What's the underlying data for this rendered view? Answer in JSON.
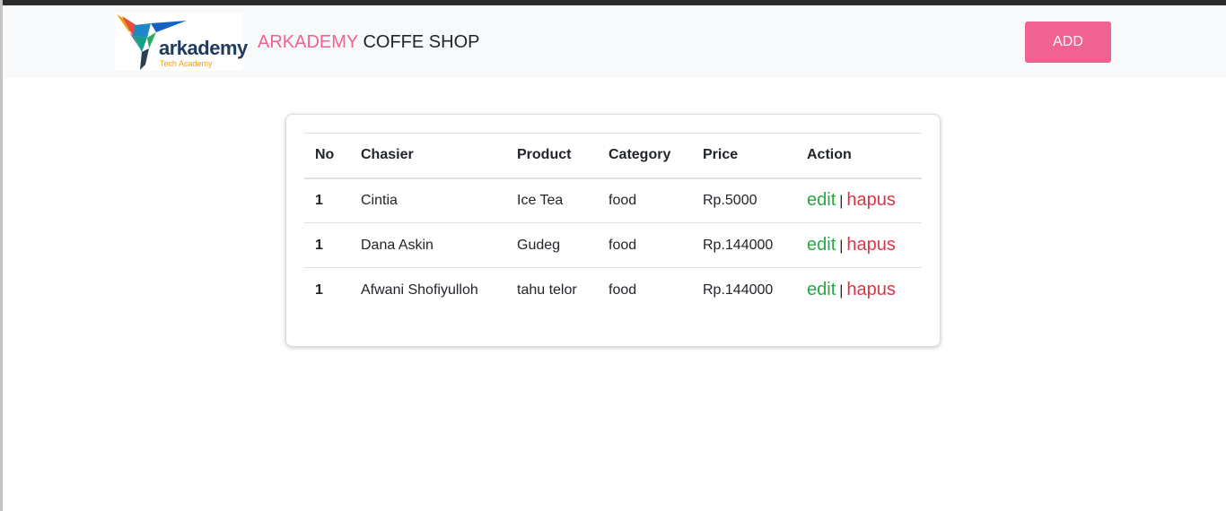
{
  "navbar": {
    "logo": {
      "icon": "hummingbird-logo-icon",
      "wordmark": "arkademy",
      "tagline": "Tech Academy"
    },
    "brand_accent": "ARKADEMY",
    "brand_rest": "COFFE SHOP",
    "add_label": "ADD"
  },
  "table": {
    "headers": [
      "No",
      "Chasier",
      "Product",
      "Category",
      "Price",
      "Action"
    ],
    "rows": [
      {
        "no": "1",
        "cashier": "Cintia",
        "product": "Ice Tea",
        "category": "food",
        "price": "Rp.5000",
        "edit": "edit",
        "sep": "|",
        "delete": "hapus"
      },
      {
        "no": "1",
        "cashier": "Dana Askin",
        "product": "Gudeg",
        "category": "food",
        "price": "Rp.144000",
        "edit": "edit",
        "sep": "|",
        "delete": "hapus"
      },
      {
        "no": "1",
        "cashier": "Afwani Shofiyulloh",
        "product": "tahu telor",
        "category": "food",
        "price": "Rp.144000",
        "edit": "edit",
        "sep": "|",
        "delete": "hapus"
      }
    ]
  },
  "colors": {
    "accent": "#f06292",
    "edit": "#28a745",
    "delete": "#dc3545",
    "navbar_bg": "#f8f9fa"
  }
}
